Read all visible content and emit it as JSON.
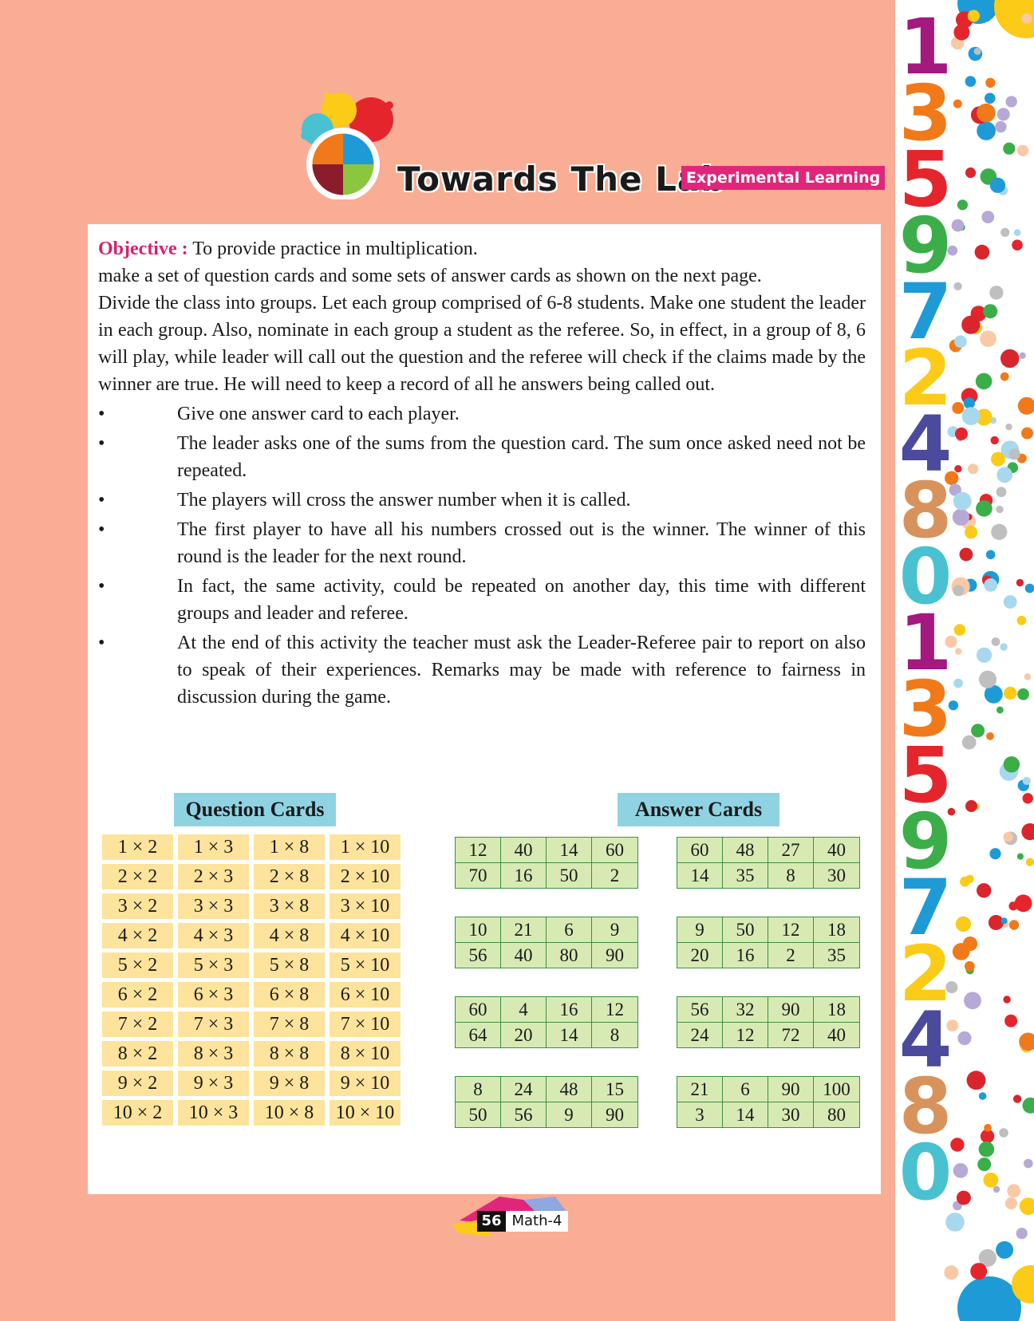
{
  "header": {
    "title": "Towards The Lab",
    "badge": "Experimental Learning"
  },
  "objective": {
    "label": "Objective :",
    "text": " To provide practice in multiplication."
  },
  "paragraphs": [
    "make a set of question cards and some sets of answer cards as shown on the next page.",
    "Divide the class into groups. Let each group comprised of 6-8 students. Make one student the leader in each group. Also, nominate in each group a student as the referee. So, in effect, in a group of 8, 6 will play, while leader will call out the question and the referee will check if the claims made by the winner are true. He will need to keep a record of all he answers being called out."
  ],
  "bullet_symbol": "•",
  "bullets": [
    "Give one answer card to each player.",
    "The leader asks one of the sums from the question card. The sum once asked need not be repeated.",
    "The players will cross the answer number when it is called.",
    "The first player to have all his numbers crossed out is the winner. The winner of this round is the leader for the next round.",
    "In fact, the same activity, could be repeated on another day, this time with different groups and leader and referee.",
    "At the end of this activity the teacher must ask the Leader-Referee pair to report on also to speak of their experiences. Remarks may be made with reference to fairness in discussion during the game."
  ],
  "question_cards": {
    "title": "Question Cards",
    "cells": [
      "1 × 2",
      "1 × 3",
      "1 × 8",
      "1 × 10",
      "2 × 2",
      "2 × 3",
      "2 × 8",
      "2 × 10",
      "3 × 2",
      "3 × 3",
      "3 × 8",
      "3 × 10",
      "4 × 2",
      "4 × 3",
      "4 × 8",
      "4 × 10",
      "5 × 2",
      "5 × 3",
      "5 × 8",
      "5 × 10",
      "6 × 2",
      "6 × 3",
      "6 × 8",
      "6 × 10",
      "7 × 2",
      "7 × 3",
      "7 × 8",
      "7 × 10",
      "8 × 2",
      "8 × 3",
      "8 × 8",
      "8 × 10",
      "9 × 2",
      "9 × 3",
      "9 × 8",
      "9 × 10",
      "10 × 2",
      "10 × 3",
      "10 × 8",
      "10 × 10"
    ]
  },
  "answer_cards": {
    "title": "Answer Cards",
    "cards": [
      [
        "12",
        "40",
        "14",
        "60",
        "70",
        "16",
        "50",
        "2"
      ],
      [
        "60",
        "48",
        "27",
        "40",
        "14",
        "35",
        "8",
        "30"
      ],
      [
        "10",
        "21",
        "6",
        "9",
        "56",
        "40",
        "80",
        "90"
      ],
      [
        "9",
        "50",
        "12",
        "18",
        "20",
        "16",
        "2",
        "35"
      ],
      [
        "60",
        "4",
        "16",
        "12",
        "64",
        "20",
        "14",
        "8"
      ],
      [
        "56",
        "32",
        "90",
        "18",
        "24",
        "12",
        "72",
        "40"
      ],
      [
        "8",
        "24",
        "48",
        "15",
        "50",
        "56",
        "9",
        "90"
      ],
      [
        "21",
        "6",
        "90",
        "100",
        "3",
        "14",
        "30",
        "80"
      ]
    ]
  },
  "sidebar_digits": [
    "1",
    "3",
    "5",
    "9",
    "7",
    "2",
    "4",
    "8",
    "0",
    "1",
    "3",
    "5",
    "9",
    "7",
    "2",
    "4",
    "8",
    "0"
  ],
  "sidebar_colors": [
    "#a3197e",
    "#f07a1a",
    "#e4262c",
    "#3bae49",
    "#1e9bd7",
    "#fbcb18",
    "#4b4a9c",
    "#d8935c",
    "#49c1d0"
  ],
  "footer": {
    "page_number": "56",
    "book": "Math-4"
  }
}
